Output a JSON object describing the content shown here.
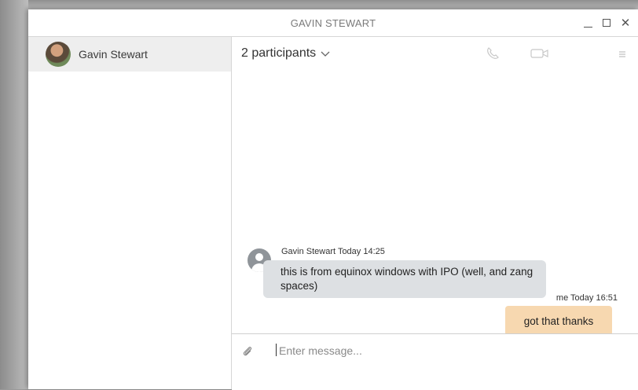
{
  "window": {
    "title": "GAVIN STEWART"
  },
  "sidebar": {
    "contacts": [
      {
        "name": "Gavin Stewart"
      }
    ]
  },
  "chat": {
    "header": {
      "participants_label": "2 participants"
    },
    "messages": [
      {
        "sender": "Gavin Stewart",
        "time": "Today 14:25",
        "meta": "Gavin Stewart Today 14:25",
        "text": "this is from equinox windows with IPO (well, and zang spaces)",
        "direction": "incoming"
      },
      {
        "sender": "me",
        "time": "Today 16:51",
        "meta": "me Today 16:51",
        "text": "got that thanks",
        "direction": "outgoing"
      }
    ],
    "composer": {
      "placeholder": "Enter message..."
    }
  },
  "colors": {
    "incoming_bubble": "#dde0e3",
    "outgoing_bubble": "#f7d8b0"
  },
  "icons": [
    "minimize-icon",
    "maximize-icon",
    "close-icon",
    "chevron-down-icon",
    "phone-icon",
    "video-camera-icon",
    "menu-icon",
    "paperclip-icon",
    "default-avatar-icon"
  ]
}
